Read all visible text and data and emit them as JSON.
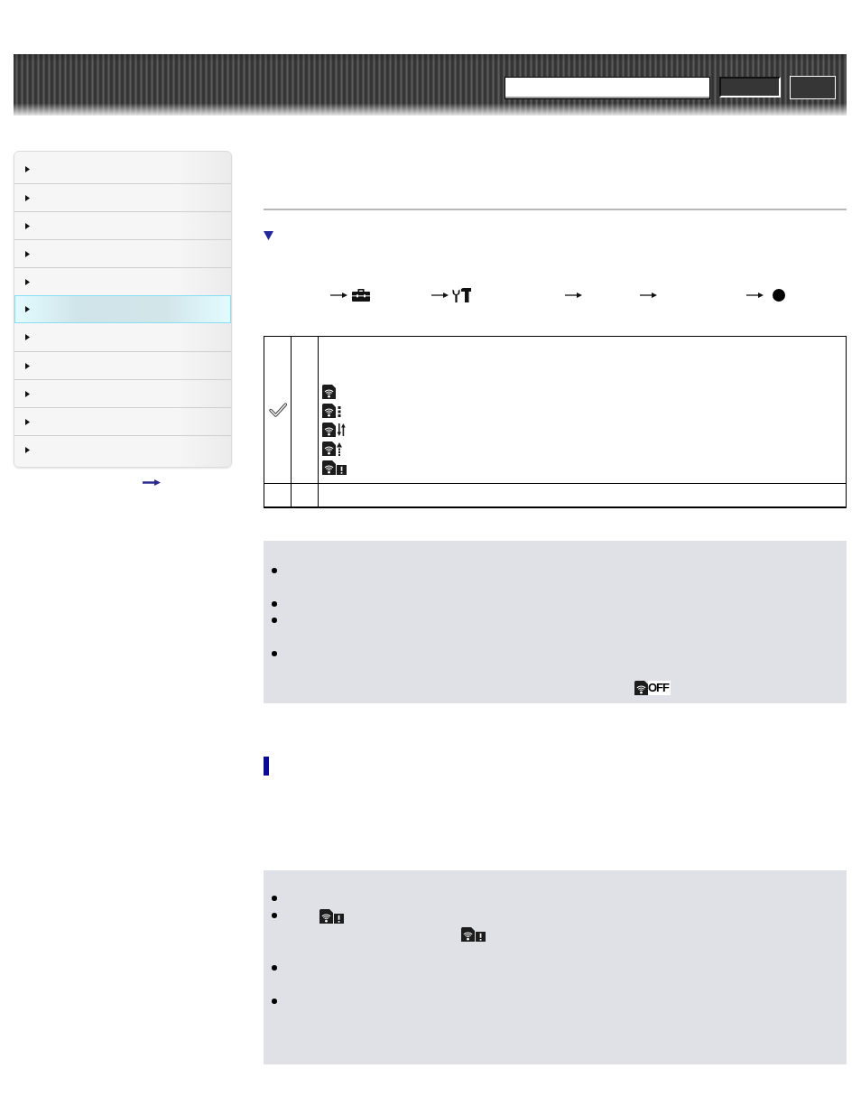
{
  "sidebar": {
    "items": [
      {
        "selected": false
      },
      {
        "selected": false
      },
      {
        "selected": false
      },
      {
        "selected": false
      },
      {
        "selected": false
      },
      {
        "selected": true
      },
      {
        "selected": false
      },
      {
        "selected": false
      },
      {
        "selected": false
      },
      {
        "selected": false
      },
      {
        "selected": false
      }
    ]
  },
  "procedure": {
    "steps": [
      {
        "kind": "toolbox"
      },
      {
        "kind": "tools"
      },
      {
        "kind": "plain"
      },
      {
        "kind": "plain"
      },
      {
        "kind": "dot"
      }
    ]
  },
  "settings_table": {
    "rows": [
      {
        "default": true,
        "indicators": [
          {
            "kind": "connected"
          },
          {
            "kind": "standby"
          },
          {
            "kind": "transfer"
          },
          {
            "kind": "upload"
          },
          {
            "kind": "error"
          }
        ]
      },
      {
        "default": false
      }
    ]
  },
  "notes": [
    {
      "items": [
        {
          "kind": "bullet"
        },
        {
          "kind": "bullet"
        },
        {
          "kind": "bullet"
        },
        {
          "kind": "bullet",
          "indicators": [
            {
              "kind": "off",
              "label": "OFF"
            }
          ]
        }
      ]
    },
    {
      "items": [
        {
          "kind": "bullet"
        },
        {
          "kind": "bullet",
          "indicators": [
            {
              "kind": "error"
            },
            {
              "kind": "error"
            }
          ]
        },
        {
          "kind": "bullet"
        },
        {
          "kind": "bullet"
        }
      ]
    }
  ]
}
